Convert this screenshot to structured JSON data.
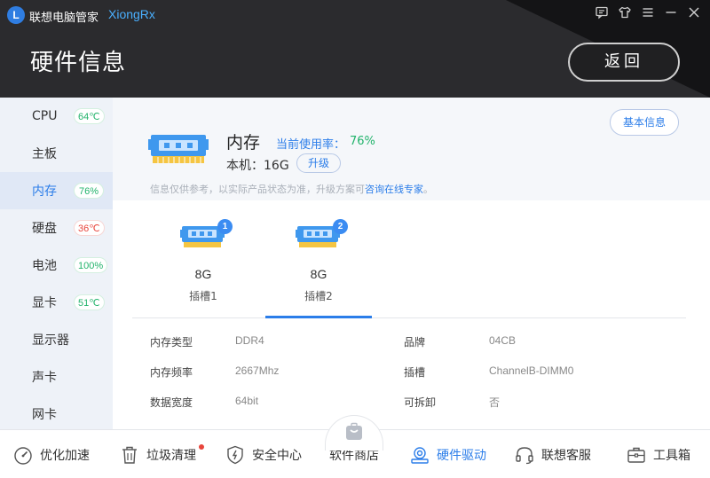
{
  "app": {
    "name": "联想电脑管家",
    "user": "XiongRx",
    "logo_letter": "L",
    "window_icons": [
      "feedback-icon",
      "skin-icon",
      "menu-icon",
      "minimize-icon",
      "close-icon"
    ]
  },
  "header": {
    "title": "硬件信息",
    "back_label": "返回"
  },
  "sidebar": {
    "items": [
      {
        "label": "CPU",
        "badge": "64℃"
      },
      {
        "label": "主板",
        "badge": ""
      },
      {
        "label": "内存",
        "badge": "76%"
      },
      {
        "label": "硬盘",
        "badge": "36℃"
      },
      {
        "label": "电池",
        "badge": "100%"
      },
      {
        "label": "显卡",
        "badge": "51℃"
      },
      {
        "label": "显示器",
        "badge": ""
      },
      {
        "label": "声卡",
        "badge": ""
      },
      {
        "label": "网卡",
        "badge": ""
      }
    ]
  },
  "memory": {
    "title": "内存",
    "usage_label": "当前使用率：",
    "usage_value": "76%",
    "local_label": "本机：16G",
    "upgrade_label": "升级",
    "basic_info_label": "基本信息",
    "note_text": "信息仅供参考，以实际产品状态为准，升级方案可",
    "note_link": "咨询在线专家",
    "note_end": "。",
    "slots": [
      {
        "number": "1",
        "size": "8G",
        "name": "插槽1"
      },
      {
        "number": "2",
        "size": "8G",
        "name": "插槽2"
      }
    ],
    "details": [
      {
        "label": "内存类型",
        "value": "DDR4"
      },
      {
        "label": "品牌",
        "value": "04CB"
      },
      {
        "label": "内存频率",
        "value": "2667Mhz"
      },
      {
        "label": "插槽",
        "value": "ChannelB-DIMM0"
      },
      {
        "label": "数据宽度",
        "value": "64bit"
      },
      {
        "label": "可拆卸",
        "value": "否"
      }
    ]
  },
  "bottom_nav": {
    "items": [
      {
        "label": "优化加速",
        "icon": "speedometer-icon"
      },
      {
        "label": "垃圾清理",
        "icon": "trash-icon"
      },
      {
        "label": "安全中心",
        "icon": "shield-icon"
      },
      {
        "label": "软件商店",
        "icon": "store-bag-icon"
      },
      {
        "label": "硬件驱动",
        "icon": "hardware-icon"
      },
      {
        "label": "联想客服",
        "icon": "headset-icon"
      },
      {
        "label": "工具箱",
        "icon": "toolbox-icon"
      }
    ]
  }
}
